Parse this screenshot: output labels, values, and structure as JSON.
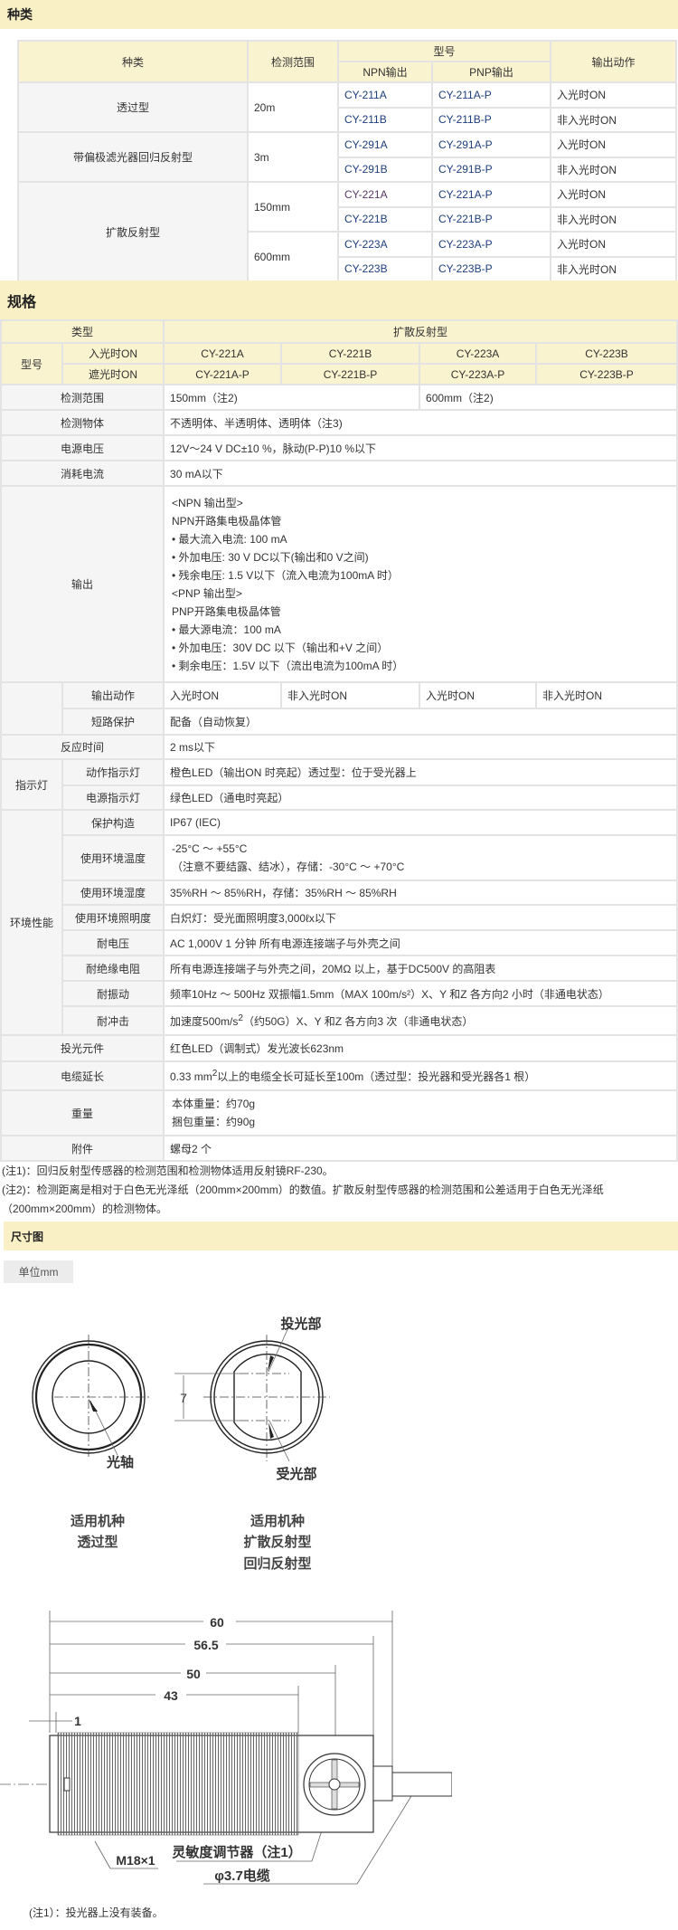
{
  "types": {
    "title": "种类",
    "headers": {
      "kind": "种类",
      "range": "检测范围",
      "model": "型号",
      "npn": "NPN输出",
      "pnp": "PNP输出",
      "action": "输出动作"
    },
    "kinds": [
      "透过型",
      "带偏极滤光器回归反射型",
      "扩散反射型"
    ],
    "ranges": [
      "20m",
      "3m",
      "150mm",
      "600mm"
    ],
    "rows": [
      {
        "npn": "CY-211A",
        "pnp": "CY-211A-P",
        "action": "入光时ON"
      },
      {
        "npn": "CY-211B",
        "pnp": "CY-211B-P",
        "action": "非入光时ON"
      },
      {
        "npn": "CY-291A",
        "pnp": "CY-291A-P",
        "action": "入光时ON"
      },
      {
        "npn": "CY-291B",
        "pnp": "CY-291B-P",
        "action": "非入光时ON"
      },
      {
        "npn": "CY-221A",
        "pnp": "CY-221A-P",
        "action": "入光时ON"
      },
      {
        "npn": "CY-221B",
        "pnp": "CY-221B-P",
        "action": "非入光时ON"
      },
      {
        "npn": "CY-223A",
        "pnp": "CY-223A-P",
        "action": "入光时ON"
      },
      {
        "npn": "CY-223B",
        "pnp": "CY-223B-P",
        "action": "非入光时ON"
      }
    ]
  },
  "specs": {
    "title": "规格",
    "type_label": "类型",
    "type_value": "扩散反射型",
    "model_label": "型号",
    "light_on": "入光时ON",
    "dark_on": "遮光时ON",
    "models_a": [
      "CY-221A",
      "CY-221B",
      "CY-223A",
      "CY-223B"
    ],
    "models_b": [
      "CY-221A-P",
      "CY-221B-P",
      "CY-223A-P",
      "CY-223B-P"
    ],
    "range_label": "检测范围",
    "range_values": [
      "150mm（注2)",
      "600mm（注2)"
    ],
    "object_label": "检测物体",
    "object_value": "不透明体、半透明体、透明体（注3)",
    "voltage_label": "电源电压",
    "voltage_value": "12V～24 V DC±10 %，脉动(P-P)10 %以下",
    "current_label": "消耗电流",
    "current_value": "30 mA以下",
    "output_label": "输出",
    "output_lines": [
      "<NPN 输出型>",
      "NPN开路集电极晶体管",
      "• 最大流入电流: 100 mA",
      "• 外加电压: 30 V DC以下(输出和0 V之间)",
      "• 残余电压: 1.5 V以下（流入电流为100mA 时）",
      "<PNP 输出型>",
      "PNP开路集电极晶体管",
      "• 最大源电流：100 mA",
      "• 外加电压：30V DC 以下（输出和+V 之间）",
      "• 剩余电压：1.5V 以下（流出电流为100mA 时）"
    ],
    "action_label": "输出动作",
    "action_values": [
      "入光时ON",
      "非入光时ON",
      "入光时ON",
      "非入光时ON"
    ],
    "short_label": "短路保护",
    "short_value": "配备（自动恢复）",
    "response_label": "反应时间",
    "response_value": "2 ms以下",
    "indicator_label": "指示灯",
    "op_ind_label": "动作指示灯",
    "op_ind_value": "橙色LED（输出ON 时亮起）透过型：位于受光器上",
    "pw_ind_label": "电源指示灯",
    "pw_ind_value": "绿色LED（通电时亮起）",
    "env_label": "环境性能",
    "protect_label": "保护构造",
    "protect_value": "IP67 (IEC)",
    "temp_label": "使用环境温度",
    "temp_line1": "-25°C ～ +55°C",
    "temp_line2": "（注意不要结露、结冰），存储：-30°C ～ +70°C",
    "humid_label": "使用环境湿度",
    "humid_value": "35%RH ～ 85%RH，存储：35%RH ～ 85%RH",
    "illum_label": "使用环境照明度",
    "illum_value": "白炽灯：受光面照明度3,000ℓx以下",
    "withstand_label": "耐电压",
    "withstand_value": "AC 1,000V 1 分钟 所有电源连接端子与外壳之间",
    "insul_label": "耐绝缘电阻",
    "insul_value": "所有电源连接端子与外壳之间，20MΩ 以上，基于DC500V 的高阻表",
    "vib_label": "耐振动",
    "vib_value": "频率10Hz ～ 500Hz 双振幅1.5mm（MAX 100m/s²）X、Y 和Z 各方向2 小时（非通电状态）",
    "shock_label": "耐冲击",
    "shock_pre": "加速度500m/s",
    "shock_sup": "2",
    "shock_post": "（约50G）X、Y 和Z 各方向3 次（非通电状态）",
    "emitter_label": "投光元件",
    "emitter_value": "红色LED（调制式）发光波长623nm",
    "cable_label": "电缆延长",
    "cable_pre": "0.33 mm",
    "cable_sup": "2",
    "cable_post": "以上的电缆全长可延长至100m（透过型：投光器和受光器各1 根）",
    "weight_label": "重量",
    "weight_lines": [
      "本体重量：约70g",
      "捆包重量：约90g"
    ],
    "acc_label": "附件",
    "acc_value": "螺母2 个"
  },
  "notes": [
    "(注1)：回归反射型传感器的检测范围和检测物体适用反射镜RF-230。",
    "(注2)：检测距离是相对于白色无光泽纸（200mm×200mm）的数值。扩散反射型传感器的检测范围和公差适用于白色无光泽纸（200mm×200mm）的检测物体。"
  ],
  "dims": {
    "title": "尺寸图",
    "unit": "单位mm",
    "optical_axis": "光轴",
    "emitter": "投光部",
    "receiver": "受光部",
    "gap": "7",
    "left_caption": [
      "适用机种",
      "透过型"
    ],
    "right_caption": [
      "适用机种",
      "扩散反射型",
      "回归反射型"
    ],
    "d60": "60",
    "d565": "56.5",
    "d50": "50",
    "d43": "43",
    "d1": "1",
    "thread": "M18×1",
    "adjuster": "灵敏度调节器（注1）",
    "cable": "φ3.7电缆",
    "note": "(注1）：投光器上没有装备。"
  }
}
